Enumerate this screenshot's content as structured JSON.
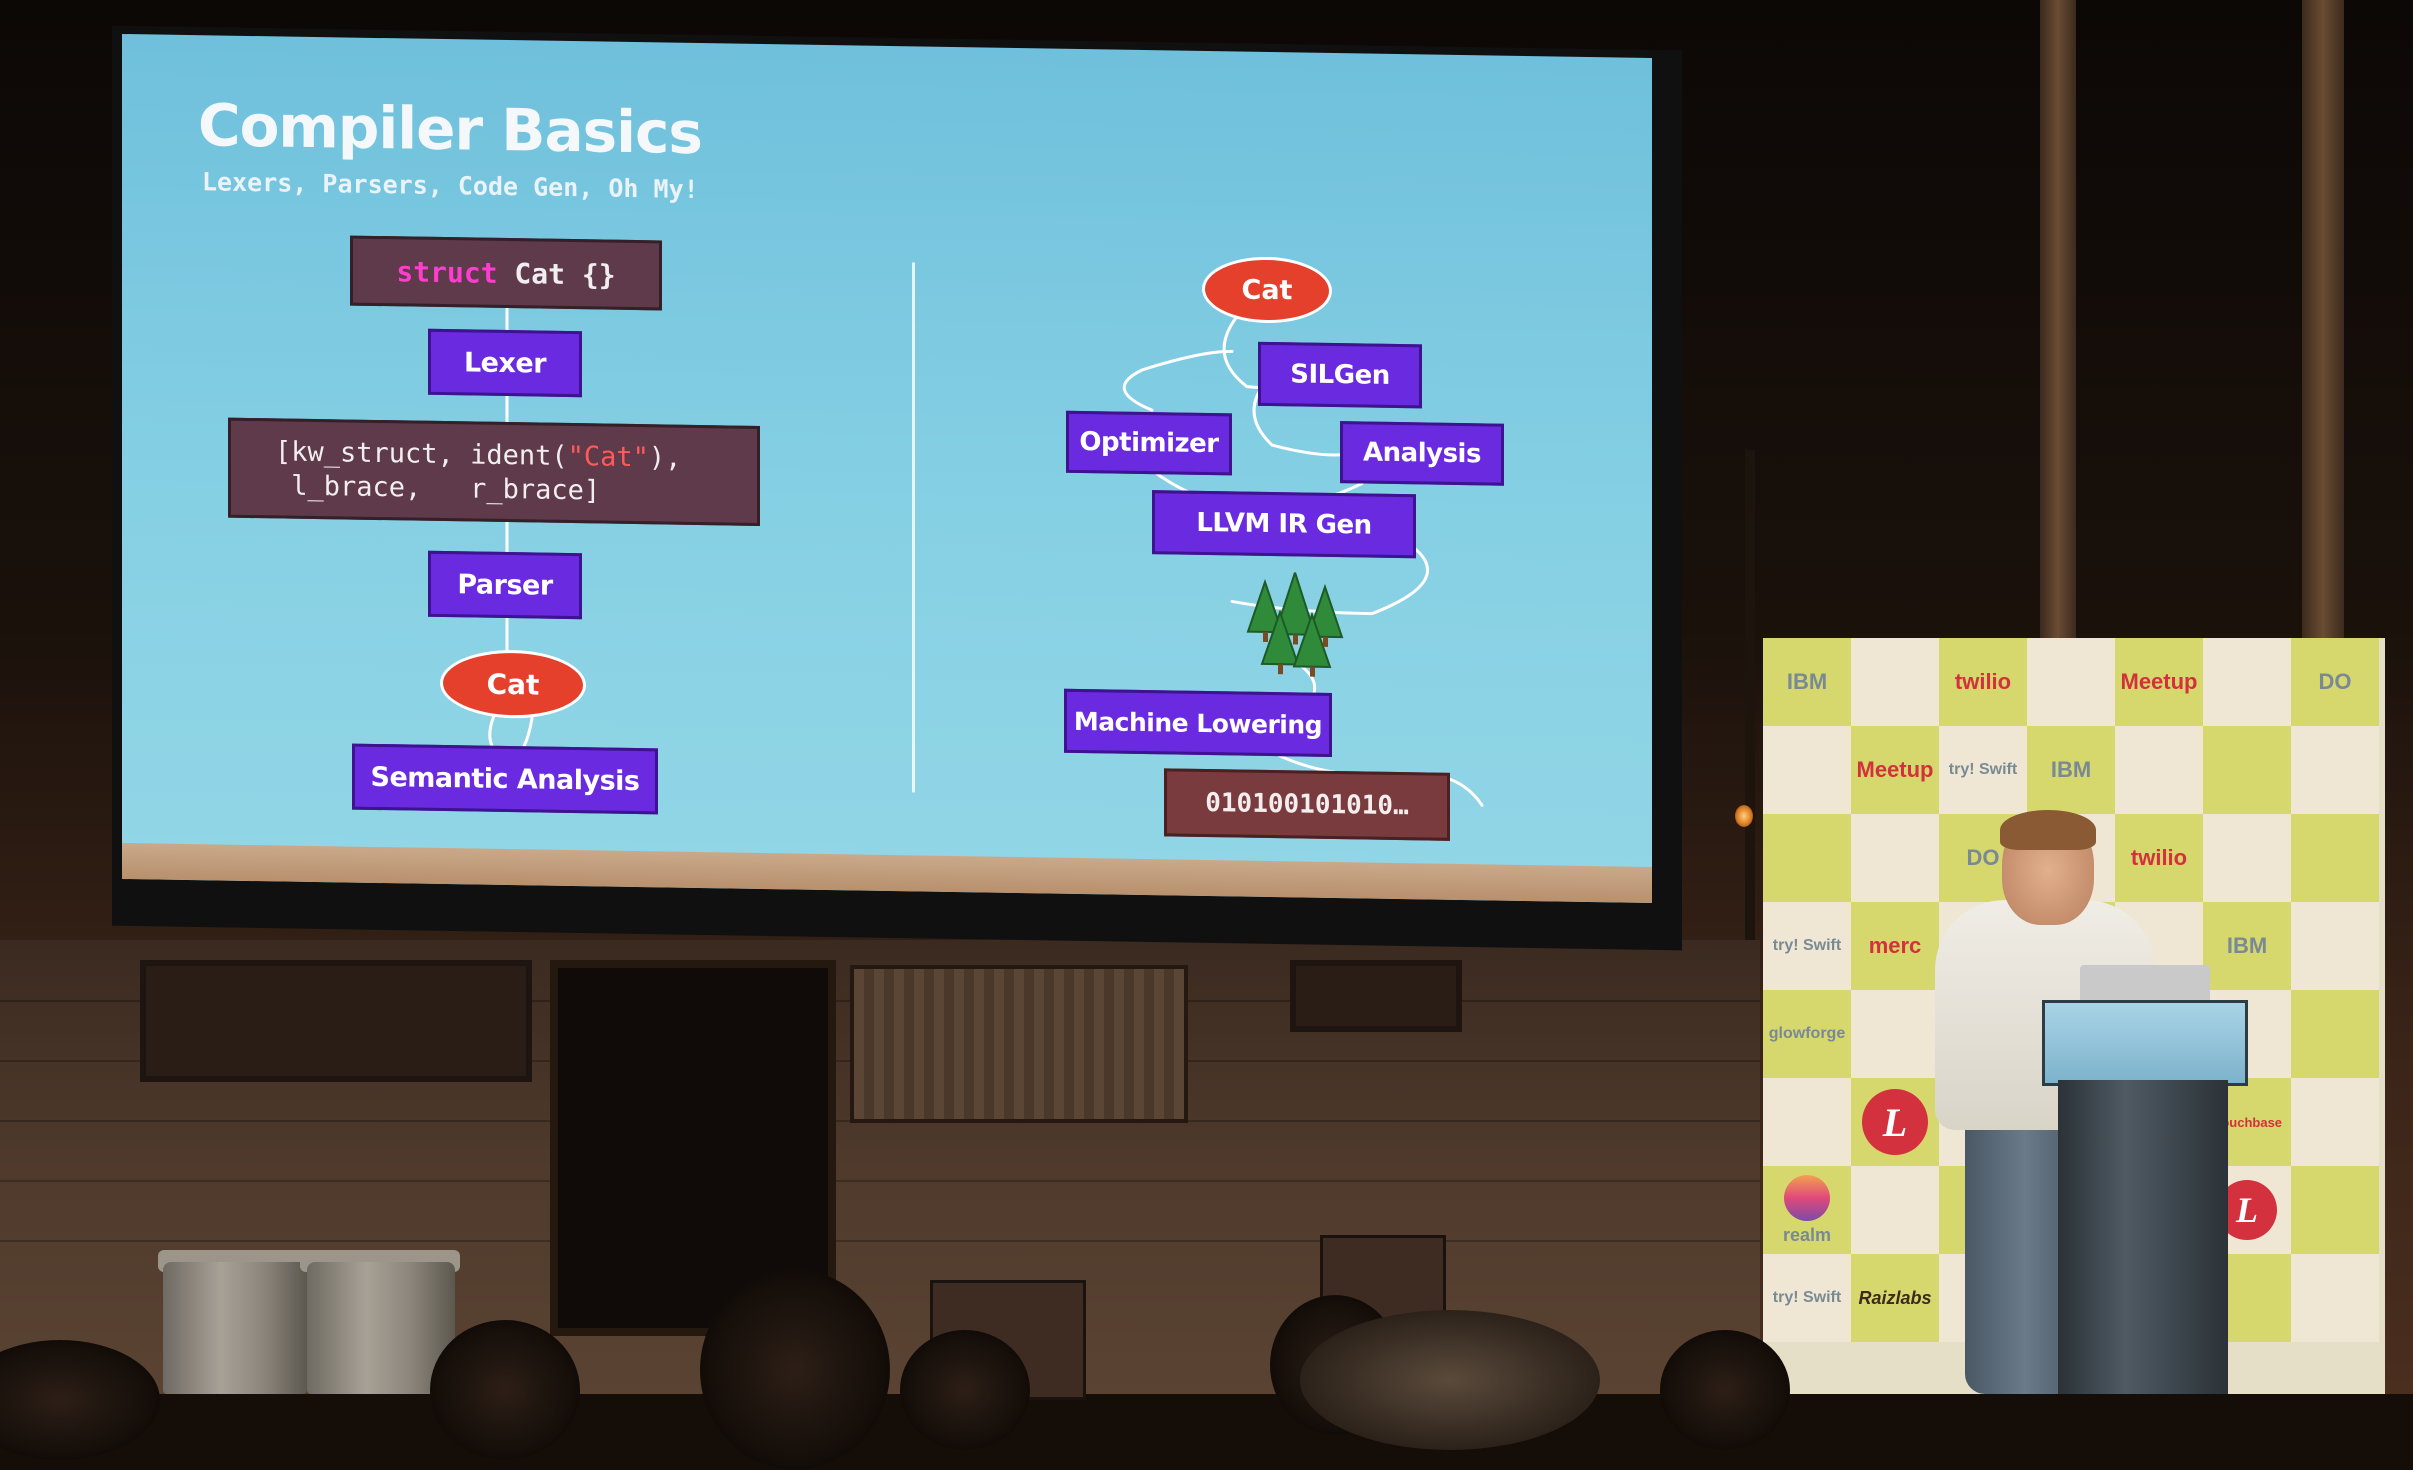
{
  "slide": {
    "title": "Compiler Basics",
    "subtitle": "Lexers, Parsers, Code Gen, Oh My!",
    "left_flow": {
      "source_keyword": "struct",
      "source_rest": " Cat {}",
      "lexer": "Lexer",
      "tokens_line1_a": "[kw_struct, ident(",
      "tokens_line1_str": "\"Cat\"",
      "tokens_line1_b": "),",
      "tokens_line2": " l_brace,   r_brace]",
      "parser": "Parser",
      "cat": "Cat",
      "semantic": "Semantic Analysis"
    },
    "right_flow": {
      "cat": "Cat",
      "silgen": "SILGen",
      "analysis": "Analysis",
      "optimizer": "Optimizer",
      "llvm": "LLVM IR Gen",
      "machine": "Machine Lowering",
      "bits": "010100101010…"
    }
  },
  "sponsors": {
    "ibm": "IBM",
    "twilio": "twilio",
    "meetup": "Meetup",
    "tryswift": "try! Swift",
    "merc": "merc",
    "glowforge": "glowforge",
    "realm": "realm",
    "raizlabs": "Raizlabs",
    "couchbase": "Couchbase",
    "do": "DO",
    "l": "L"
  },
  "colors": {
    "slide_bg": "#86d0e4",
    "stage_purple": "#6a2ae0",
    "code_box": "#5e3a4a",
    "oval_red": "#e4402c",
    "keyword_pink": "#ff3cd0"
  }
}
